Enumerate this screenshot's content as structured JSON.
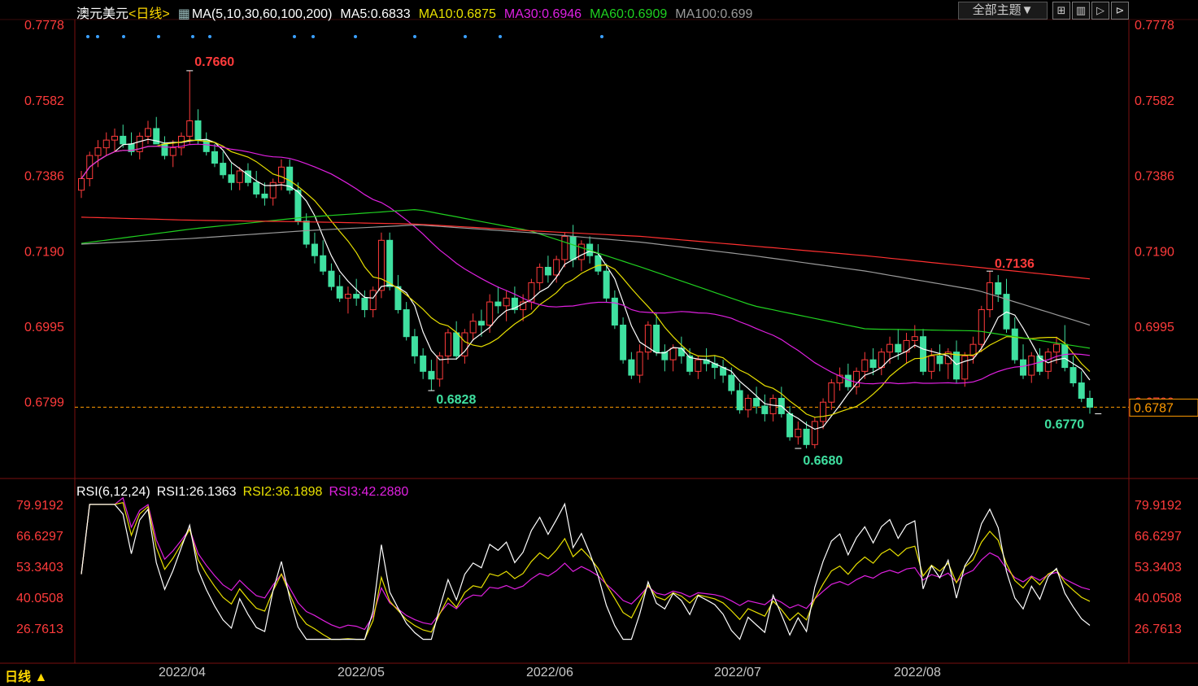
{
  "header": {
    "symbol": "澳元美元",
    "period_tag": "<日线>",
    "ma_label": "MA(5,10,30,60,100,200)",
    "ma5": "MA5:0.6833",
    "ma10": "MA10:0.6875",
    "ma30": "MA30:0.6946",
    "ma60": "MA60:0.6909",
    "ma100": "MA100:0.699"
  },
  "toolbar": {
    "theme_label": "全部主题▼",
    "icons": [
      "grid-icon",
      "layout-icon",
      "play-icon",
      "next-icon"
    ]
  },
  "price_axis": [
    "0.7778",
    "0.7582",
    "0.7386",
    "0.7190",
    "0.6995",
    "0.6799"
  ],
  "current_price": "0.6787",
  "annotations": {
    "high": "0.7660",
    "low_may": "0.6828",
    "low_jul": "0.6680",
    "high_aug": "0.7136",
    "last_low": "0.6770"
  },
  "rsi": {
    "label": "RSI(6,12,24)",
    "rsi1": "RSI1:26.1363",
    "rsi2": "RSI2:36.1898",
    "rsi3": "RSI3:42.2880",
    "axis": [
      "79.9192",
      "66.6297",
      "53.3403",
      "40.0508",
      "26.7613"
    ]
  },
  "dates": [
    "2022/04",
    "2022/05",
    "2022/06",
    "2022/07",
    "2022/08"
  ],
  "period_button": "日线 ▲",
  "colors": {
    "up": "#ff3b3b",
    "down": "#3fe0a0",
    "ma5": "#ffffff",
    "ma10": "#e8e000",
    "ma30": "#e020e0",
    "ma60": "#20d020",
    "ma100": "#9a9a9a",
    "ma200": "#ff3030",
    "axis_text": "#ff3b3b",
    "price_line": "#ff9a00"
  },
  "chart_data": {
    "type": "candlestick",
    "y_range": [
      0.664,
      0.7778
    ],
    "candles_approx": [
      [
        0.735,
        0.74,
        0.733,
        0.738
      ],
      [
        0.738,
        0.745,
        0.736,
        0.744
      ],
      [
        0.744,
        0.748,
        0.741,
        0.746
      ],
      [
        0.746,
        0.75,
        0.744,
        0.748
      ],
      [
        0.748,
        0.751,
        0.745,
        0.749
      ],
      [
        0.749,
        0.752,
        0.746,
        0.747
      ],
      [
        0.747,
        0.75,
        0.744,
        0.745
      ],
      [
        0.745,
        0.75,
        0.743,
        0.749
      ],
      [
        0.749,
        0.753,
        0.747,
        0.751
      ],
      [
        0.751,
        0.754,
        0.748,
        0.747
      ],
      [
        0.747,
        0.749,
        0.743,
        0.744
      ],
      [
        0.744,
        0.748,
        0.741,
        0.746
      ],
      [
        0.746,
        0.75,
        0.744,
        0.749
      ],
      [
        0.749,
        0.766,
        0.747,
        0.753
      ],
      [
        0.753,
        0.756,
        0.747,
        0.748
      ],
      [
        0.748,
        0.75,
        0.744,
        0.745
      ],
      [
        0.745,
        0.747,
        0.741,
        0.742
      ],
      [
        0.742,
        0.745,
        0.738,
        0.739
      ],
      [
        0.739,
        0.742,
        0.735,
        0.737
      ],
      [
        0.737,
        0.741,
        0.735,
        0.74
      ],
      [
        0.74,
        0.742,
        0.736,
        0.737
      ],
      [
        0.737,
        0.74,
        0.733,
        0.734
      ],
      [
        0.734,
        0.737,
        0.731,
        0.733
      ],
      [
        0.733,
        0.738,
        0.731,
        0.737
      ],
      [
        0.737,
        0.743,
        0.735,
        0.741
      ],
      [
        0.741,
        0.743,
        0.734,
        0.735
      ],
      [
        0.735,
        0.737,
        0.726,
        0.727
      ],
      [
        0.727,
        0.729,
        0.72,
        0.721
      ],
      [
        0.721,
        0.724,
        0.716,
        0.718
      ],
      [
        0.718,
        0.722,
        0.713,
        0.714
      ],
      [
        0.714,
        0.716,
        0.709,
        0.71
      ],
      [
        0.71,
        0.713,
        0.706,
        0.707
      ],
      [
        0.707,
        0.71,
        0.703,
        0.708
      ],
      [
        0.708,
        0.712,
        0.705,
        0.707
      ],
      [
        0.707,
        0.709,
        0.702,
        0.704
      ],
      [
        0.704,
        0.71,
        0.702,
        0.709
      ],
      [
        0.709,
        0.724,
        0.707,
        0.722
      ],
      [
        0.722,
        0.724,
        0.709,
        0.71
      ],
      [
        0.71,
        0.713,
        0.703,
        0.704
      ],
      [
        0.704,
        0.706,
        0.696,
        0.697
      ],
      [
        0.697,
        0.699,
        0.69,
        0.692
      ],
      [
        0.692,
        0.694,
        0.686,
        0.688
      ],
      [
        0.688,
        0.691,
        0.683,
        0.686
      ],
      [
        0.686,
        0.693,
        0.684,
        0.692
      ],
      [
        0.692,
        0.699,
        0.69,
        0.698
      ],
      [
        0.698,
        0.701,
        0.691,
        0.692
      ],
      [
        0.692,
        0.699,
        0.69,
        0.698
      ],
      [
        0.698,
        0.703,
        0.696,
        0.701
      ],
      [
        0.701,
        0.704,
        0.697,
        0.7
      ],
      [
        0.7,
        0.708,
        0.698,
        0.706
      ],
      [
        0.706,
        0.71,
        0.703,
        0.705
      ],
      [
        0.705,
        0.709,
        0.701,
        0.707
      ],
      [
        0.707,
        0.71,
        0.703,
        0.704
      ],
      [
        0.704,
        0.708,
        0.701,
        0.706
      ],
      [
        0.706,
        0.712,
        0.704,
        0.711
      ],
      [
        0.711,
        0.716,
        0.709,
        0.715
      ],
      [
        0.715,
        0.718,
        0.711,
        0.713
      ],
      [
        0.713,
        0.718,
        0.711,
        0.717
      ],
      [
        0.717,
        0.724,
        0.715,
        0.723
      ],
      [
        0.723,
        0.726,
        0.715,
        0.717
      ],
      [
        0.717,
        0.722,
        0.714,
        0.721
      ],
      [
        0.721,
        0.723,
        0.716,
        0.718
      ],
      [
        0.718,
        0.721,
        0.713,
        0.714
      ],
      [
        0.714,
        0.716,
        0.706,
        0.707
      ],
      [
        0.707,
        0.709,
        0.699,
        0.7
      ],
      [
        0.7,
        0.702,
        0.69,
        0.691
      ],
      [
        0.691,
        0.693,
        0.686,
        0.687
      ],
      [
        0.687,
        0.695,
        0.685,
        0.693
      ],
      [
        0.693,
        0.701,
        0.691,
        0.7
      ],
      [
        0.7,
        0.703,
        0.692,
        0.693
      ],
      [
        0.693,
        0.695,
        0.688,
        0.691
      ],
      [
        0.691,
        0.695,
        0.688,
        0.694
      ],
      [
        0.694,
        0.697,
        0.69,
        0.692
      ],
      [
        0.692,
        0.694,
        0.687,
        0.688
      ],
      [
        0.688,
        0.692,
        0.686,
        0.691
      ],
      [
        0.691,
        0.694,
        0.688,
        0.69
      ],
      [
        0.69,
        0.692,
        0.686,
        0.689
      ],
      [
        0.689,
        0.691,
        0.685,
        0.687
      ],
      [
        0.687,
        0.689,
        0.682,
        0.683
      ],
      [
        0.683,
        0.685,
        0.677,
        0.678
      ],
      [
        0.678,
        0.682,
        0.676,
        0.681
      ],
      [
        0.681,
        0.684,
        0.677,
        0.679
      ],
      [
        0.679,
        0.682,
        0.675,
        0.677
      ],
      [
        0.677,
        0.682,
        0.675,
        0.681
      ],
      [
        0.681,
        0.684,
        0.676,
        0.677
      ],
      [
        0.677,
        0.679,
        0.67,
        0.671
      ],
      [
        0.671,
        0.675,
        0.669,
        0.673
      ],
      [
        0.673,
        0.675,
        0.668,
        0.669
      ],
      [
        0.669,
        0.676,
        0.668,
        0.675
      ],
      [
        0.675,
        0.681,
        0.673,
        0.68
      ],
      [
        0.68,
        0.686,
        0.678,
        0.685
      ],
      [
        0.685,
        0.689,
        0.683,
        0.687
      ],
      [
        0.687,
        0.69,
        0.683,
        0.684
      ],
      [
        0.684,
        0.689,
        0.682,
        0.688
      ],
      [
        0.688,
        0.693,
        0.686,
        0.691
      ],
      [
        0.691,
        0.694,
        0.687,
        0.689
      ],
      [
        0.689,
        0.694,
        0.687,
        0.693
      ],
      [
        0.693,
        0.697,
        0.69,
        0.695
      ],
      [
        0.695,
        0.699,
        0.691,
        0.693
      ],
      [
        0.693,
        0.698,
        0.69,
        0.696
      ],
      [
        0.696,
        0.7,
        0.694,
        0.697
      ],
      [
        0.697,
        0.699,
        0.687,
        0.688
      ],
      [
        0.688,
        0.694,
        0.686,
        0.692
      ],
      [
        0.692,
        0.695,
        0.688,
        0.69
      ],
      [
        0.69,
        0.694,
        0.686,
        0.693
      ],
      [
        0.693,
        0.696,
        0.685,
        0.686
      ],
      [
        0.686,
        0.693,
        0.684,
        0.692
      ],
      [
        0.692,
        0.697,
        0.69,
        0.695
      ],
      [
        0.695,
        0.705,
        0.693,
        0.704
      ],
      [
        0.704,
        0.714,
        0.702,
        0.711
      ],
      [
        0.711,
        0.713,
        0.706,
        0.708
      ],
      [
        0.708,
        0.712,
        0.698,
        0.699
      ],
      [
        0.699,
        0.702,
        0.69,
        0.691
      ],
      [
        0.691,
        0.695,
        0.686,
        0.687
      ],
      [
        0.687,
        0.693,
        0.685,
        0.692
      ],
      [
        0.692,
        0.694,
        0.687,
        0.688
      ],
      [
        0.688,
        0.694,
        0.686,
        0.693
      ],
      [
        0.693,
        0.697,
        0.69,
        0.695
      ],
      [
        0.695,
        0.7,
        0.688,
        0.689
      ],
      [
        0.689,
        0.692,
        0.684,
        0.685
      ],
      [
        0.685,
        0.688,
        0.68,
        0.681
      ],
      [
        0.681,
        0.683,
        0.677,
        0.6787
      ]
    ]
  }
}
